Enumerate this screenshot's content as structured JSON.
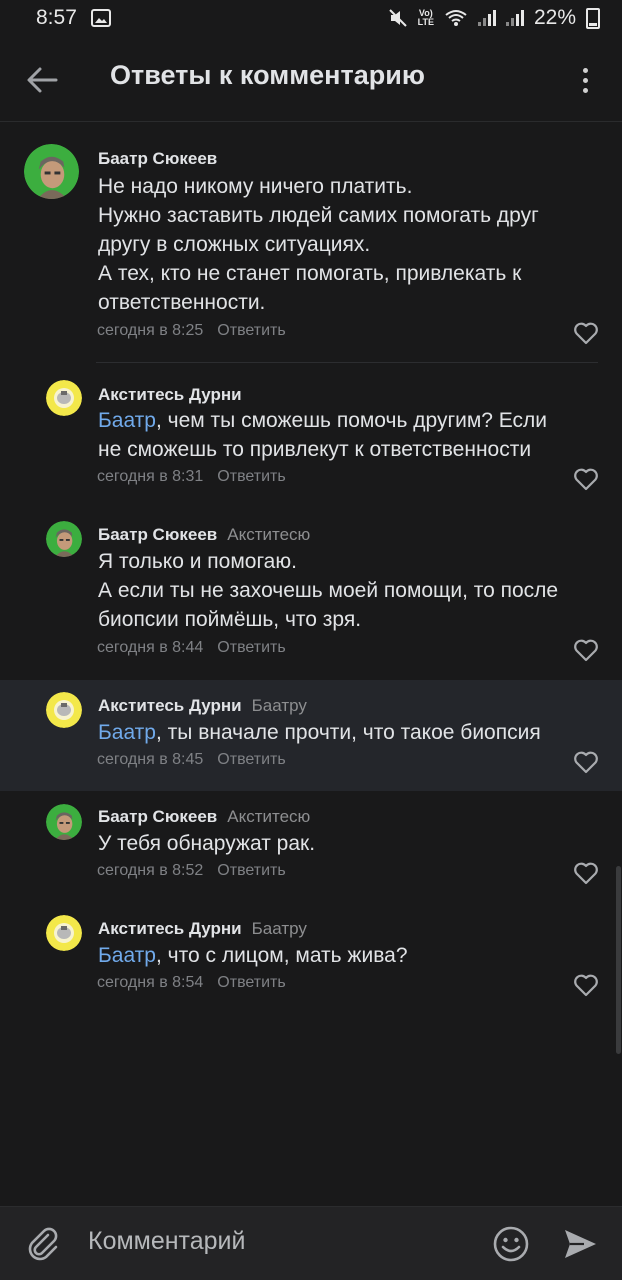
{
  "status": {
    "time": "8:57",
    "battery": "22%",
    "lte_top": "Vo)",
    "lte_bottom": "LTE"
  },
  "header": {
    "title": "Ответы к комментарию"
  },
  "comments": [
    {
      "author": "Баатр Сюкеев",
      "reply_to": "",
      "mention": "",
      "text_lines": [
        "Не надо никому ничего платить.",
        "Нужно заставить людей самих помогать друг",
        "другу в сложных ситуациях.",
        "А тех, кто не станет помогать, привлекать к",
        "ответственности."
      ],
      "time": "сегодня в 8:25",
      "reply_label": "Ответить"
    },
    {
      "author": "Акститесь Дурни",
      "reply_to": "",
      "mention": "Баатр",
      "text_lines": [
        ", чем ты сможешь помочь другим? Если",
        "не сможешь то привлекут к ответственности"
      ],
      "time": "сегодня в 8:31",
      "reply_label": "Ответить"
    },
    {
      "author": "Баатр Сюкеев",
      "reply_to": "Акститесю",
      "mention": "",
      "text_lines": [
        "Я только и помогаю.",
        "А если ты не захочешь моей помощи, то после",
        "биопсии поймёшь, что зря."
      ],
      "time": "сегодня в 8:44",
      "reply_label": "Ответить"
    },
    {
      "author": "Акститесь Дурни",
      "reply_to": "Баатру",
      "mention": "Баатр",
      "text_lines": [
        ", ты вначале прочти, что такое биопсия"
      ],
      "time": "сегодня в 8:45",
      "reply_label": "Ответить"
    },
    {
      "author": "Баатр Сюкеев",
      "reply_to": "Акститесю",
      "mention": "",
      "text_lines": [
        "У тебя обнаружат рак."
      ],
      "time": "сегодня в 8:52",
      "reply_label": "Ответить"
    },
    {
      "author": "Акститесь Дурни",
      "reply_to": "Баатру",
      "mention": "Баатр",
      "text_lines": [
        ", что с лицом, мать жива?"
      ],
      "time": "сегодня в 8:54",
      "reply_label": "Ответить"
    }
  ],
  "composer": {
    "placeholder": "Комментарий"
  },
  "colors": {
    "background": "#19191a",
    "mention": "#71aaeb",
    "avatar_green": "#3cae3f",
    "avatar_yellow": "#f3e84a"
  }
}
